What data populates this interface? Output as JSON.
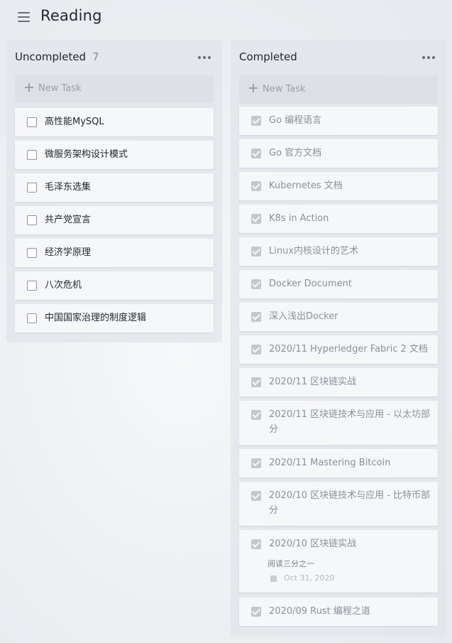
{
  "app": {
    "title": "Reading",
    "menu_icon": "hamburger-menu-icon"
  },
  "columns": {
    "uncompleted": {
      "title": "Uncompleted",
      "count": "7",
      "more_icon": "more-horizontal-icon",
      "new_task_label": "New Task",
      "tasks": [
        "高性能MySQL",
        "微服务架构设计模式",
        "毛泽东选集",
        "共产党宣言",
        "经济学原理",
        "八次危机",
        "中国国家治理的制度逻辑"
      ]
    },
    "completed": {
      "title": "Completed",
      "more_icon": "more-horizontal-icon",
      "new_task_label": "New Task",
      "tasks": [
        "Go 编程语言",
        "Go 官方文档",
        "Kubernetes 文档",
        "K8s in Action",
        "Linux内核设计的艺术",
        "Docker Document",
        "深入浅出Docker",
        "2020/11 Hyperledger Fabric 2 文档",
        "2020/11 区块链实战",
        "2020/11 区块链技术与应用 - 以太坊部分",
        "2020/11 Mastering Bitcoin",
        "2020/10 区块链技术与应用 - 比特币部分",
        "2020/10 区块链实战",
        "2020/09 Rust 编程之道"
      ],
      "task_13_note": "阅读三分之一",
      "task_13_date": "Oct 31, 2020"
    }
  }
}
